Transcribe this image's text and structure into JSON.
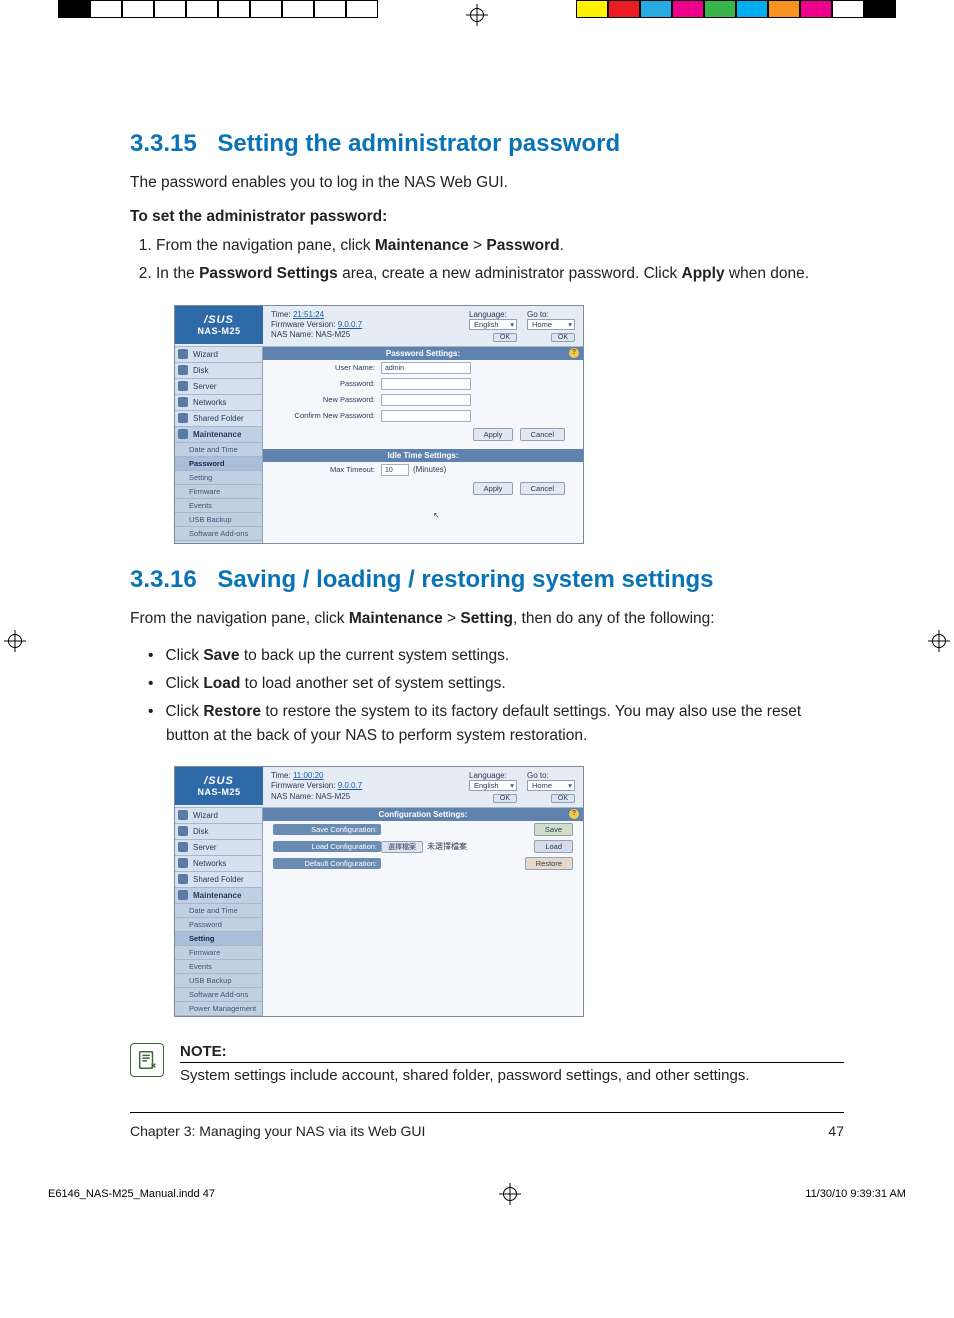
{
  "print": {
    "left_swatches": [
      "#000000",
      "#ffffff",
      "#ffffff",
      "#ffffff",
      "#ffffff",
      "#ffffff",
      "#ffffff",
      "#ffffff",
      "#ffffff",
      "#ffffff"
    ],
    "right_swatches": [
      "#fef200",
      "#ed1c24",
      "#29a9e1",
      "#ec008c",
      "#39b54a",
      "#00adef",
      "#f7941e",
      "#ec008c",
      "#ffffff",
      "#000000"
    ]
  },
  "sec1": {
    "number": "3.3.15",
    "title": "Setting the administrator password",
    "intro": "The password enables you to log in the NAS Web GUI.",
    "lead": "To set the administrator password:",
    "steps": [
      {
        "pre": "From the navigation pane, click ",
        "b1": "Maintenance",
        "mid": " > ",
        "b2": "Password",
        "post": "."
      },
      {
        "pre": "In the ",
        "b1": "Password Settings",
        "mid": " area, create a new administrator password. Click ",
        "b2": "Apply",
        "post": " when done."
      }
    ]
  },
  "shot1": {
    "brand_model": "NAS-M25",
    "time_lbl": "Time:",
    "time_val": "21:51:24",
    "fw_lbl": "Firmware Version:",
    "fw_val": "9.0.0.7",
    "name_lbl": "NAS Name:",
    "name_val": "NAS-M25",
    "lang_lbl": "Language:",
    "lang_val": "English",
    "goto_lbl": "Go to:",
    "goto_val": "Home",
    "ok": "OK",
    "nav": [
      "Wizard",
      "Disk",
      "Server",
      "Networks",
      "Shared Folder",
      "Maintenance"
    ],
    "sub": [
      "Date and Time",
      "Password",
      "Setting",
      "Firmware",
      "Events",
      "USB Backup",
      "Software Add-ons"
    ],
    "sub_active": "Password",
    "nav_sel": "Maintenance",
    "panel1": "Password Settings:",
    "labels": {
      "user": "User Name:",
      "user_val": "admin",
      "pw": "Password:",
      "npw": "New Password:",
      "cpw": "Confirm New Password:"
    },
    "panel2": "Idle Time Settings:",
    "timeout_lbl": "Max Timeout:",
    "timeout_val": "10",
    "timeout_unit": "(Minutes)",
    "apply": "Apply",
    "cancel": "Cancel"
  },
  "sec2": {
    "number": "3.3.16",
    "title": "Saving / loading / restoring system settings",
    "intro_pre": "From the navigation pane, click ",
    "intro_b1": "Maintenance",
    "intro_mid": " > ",
    "intro_b2": "Setting",
    "intro_post": ", then do any of the following:",
    "bullets": [
      {
        "pre": "Click ",
        "b": "Save",
        "post": " to back up the current system settings."
      },
      {
        "pre": "Click ",
        "b": "Load",
        "post": " to load another set of system settings."
      },
      {
        "pre": "Click ",
        "b": "Restore",
        "post": " to restore the system to its factory default settings. You may also use the reset button at the back of your NAS to perform system restoration."
      }
    ]
  },
  "shot2": {
    "brand_model": "NAS-M25",
    "time_lbl": "Time:",
    "time_val": "11:00:20",
    "fw_lbl": "Firmware Version:",
    "fw_val": "9.0.0.7",
    "name_lbl": "NAS Name:",
    "name_val": "NAS-M25",
    "lang_lbl": "Language:",
    "lang_val": "English",
    "goto_lbl": "Go to:",
    "goto_val": "Home",
    "ok": "OK",
    "nav": [
      "Wizard",
      "Disk",
      "Server",
      "Networks",
      "Shared Folder",
      "Maintenance"
    ],
    "sub": [
      "Date and Time",
      "Password",
      "Setting",
      "Firmware",
      "Events",
      "USB Backup",
      "Software Add-ons",
      "Power Management"
    ],
    "sub_active": "Setting",
    "nav_sel": "Maintenance",
    "panel": "Configuration Settings:",
    "rows": {
      "save_lbl": "Save Configuration:",
      "load_lbl": "Load Configuration:",
      "browse": "選擇檔案",
      "nofile": "未選擇檔案",
      "def_lbl": "Default Configuration:"
    },
    "save": "Save",
    "load": "Load",
    "restore": "Restore"
  },
  "note": {
    "heading": "NOTE:",
    "body": "System settings include account, shared folder, password settings, and other settings."
  },
  "footer": {
    "chapter": "Chapter 3: Managing your NAS via its Web GUI",
    "page": "47"
  },
  "indd": {
    "file": "E6146_NAS-M25_Manual.indd   47",
    "stamp": "11/30/10   9:39:31 AM"
  }
}
